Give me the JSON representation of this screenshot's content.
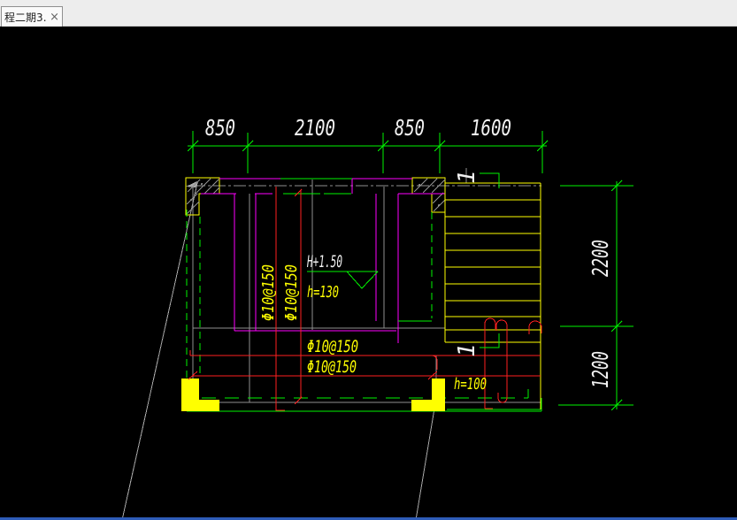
{
  "window": {
    "tab_title": "程二期3…",
    "close_label": "×"
  },
  "dims": {
    "top": [
      "850",
      "2100",
      "850",
      "1600"
    ],
    "right": [
      "2200",
      "1200"
    ]
  },
  "labels": {
    "elevation": "H+1.50",
    "depth_main": "h=130",
    "depth_pit": "h=100",
    "rebar_wall_a": "Φ10@150",
    "rebar_wall_b": "Φ10@150",
    "rebar_slab_a": "Φ10@150",
    "rebar_slab_b": "Φ10@150",
    "section_top": "1",
    "section_bottom": "1"
  },
  "colors": {
    "dimension_green": "#00f400",
    "wall_magenta": "#ff00ff",
    "rebar_red": "#ff2020",
    "steel_yellow": "#ffff00",
    "note_white": "#f2f2f2",
    "construction_gray": "#8f8f8f",
    "status_strip_blue": "#2e5cb8",
    "canvas_black": "#000000",
    "tabbar_gray": "#ededed"
  }
}
